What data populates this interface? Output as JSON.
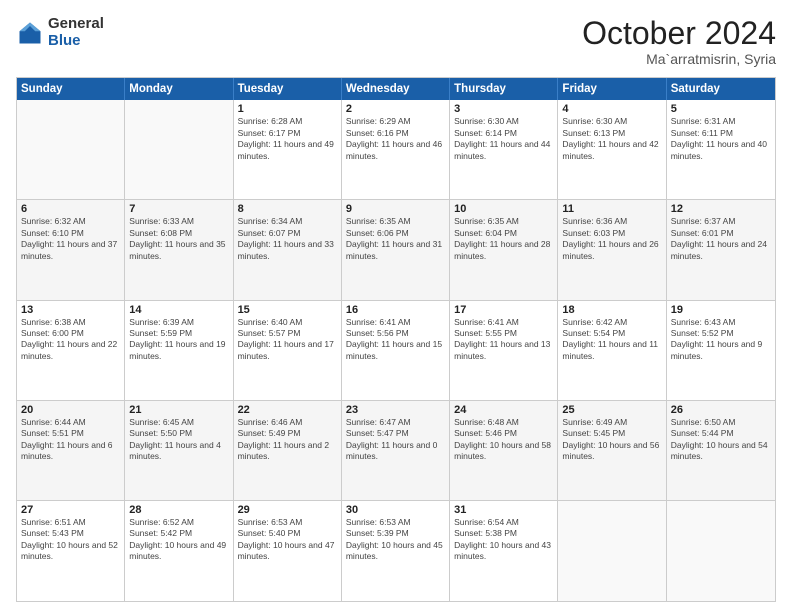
{
  "logo": {
    "general": "General",
    "blue": "Blue"
  },
  "header": {
    "month": "October 2024",
    "location": "Ma`arratmisrin, Syria"
  },
  "weekdays": [
    "Sunday",
    "Monday",
    "Tuesday",
    "Wednesday",
    "Thursday",
    "Friday",
    "Saturday"
  ],
  "weeks": [
    [
      {
        "day": "",
        "info": ""
      },
      {
        "day": "",
        "info": ""
      },
      {
        "day": "1",
        "info": "Sunrise: 6:28 AM\nSunset: 6:17 PM\nDaylight: 11 hours and 49 minutes."
      },
      {
        "day": "2",
        "info": "Sunrise: 6:29 AM\nSunset: 6:16 PM\nDaylight: 11 hours and 46 minutes."
      },
      {
        "day": "3",
        "info": "Sunrise: 6:30 AM\nSunset: 6:14 PM\nDaylight: 11 hours and 44 minutes."
      },
      {
        "day": "4",
        "info": "Sunrise: 6:30 AM\nSunset: 6:13 PM\nDaylight: 11 hours and 42 minutes."
      },
      {
        "day": "5",
        "info": "Sunrise: 6:31 AM\nSunset: 6:11 PM\nDaylight: 11 hours and 40 minutes."
      }
    ],
    [
      {
        "day": "6",
        "info": "Sunrise: 6:32 AM\nSunset: 6:10 PM\nDaylight: 11 hours and 37 minutes."
      },
      {
        "day": "7",
        "info": "Sunrise: 6:33 AM\nSunset: 6:08 PM\nDaylight: 11 hours and 35 minutes."
      },
      {
        "day": "8",
        "info": "Sunrise: 6:34 AM\nSunset: 6:07 PM\nDaylight: 11 hours and 33 minutes."
      },
      {
        "day": "9",
        "info": "Sunrise: 6:35 AM\nSunset: 6:06 PM\nDaylight: 11 hours and 31 minutes."
      },
      {
        "day": "10",
        "info": "Sunrise: 6:35 AM\nSunset: 6:04 PM\nDaylight: 11 hours and 28 minutes."
      },
      {
        "day": "11",
        "info": "Sunrise: 6:36 AM\nSunset: 6:03 PM\nDaylight: 11 hours and 26 minutes."
      },
      {
        "day": "12",
        "info": "Sunrise: 6:37 AM\nSunset: 6:01 PM\nDaylight: 11 hours and 24 minutes."
      }
    ],
    [
      {
        "day": "13",
        "info": "Sunrise: 6:38 AM\nSunset: 6:00 PM\nDaylight: 11 hours and 22 minutes."
      },
      {
        "day": "14",
        "info": "Sunrise: 6:39 AM\nSunset: 5:59 PM\nDaylight: 11 hours and 19 minutes."
      },
      {
        "day": "15",
        "info": "Sunrise: 6:40 AM\nSunset: 5:57 PM\nDaylight: 11 hours and 17 minutes."
      },
      {
        "day": "16",
        "info": "Sunrise: 6:41 AM\nSunset: 5:56 PM\nDaylight: 11 hours and 15 minutes."
      },
      {
        "day": "17",
        "info": "Sunrise: 6:41 AM\nSunset: 5:55 PM\nDaylight: 11 hours and 13 minutes."
      },
      {
        "day": "18",
        "info": "Sunrise: 6:42 AM\nSunset: 5:54 PM\nDaylight: 11 hours and 11 minutes."
      },
      {
        "day": "19",
        "info": "Sunrise: 6:43 AM\nSunset: 5:52 PM\nDaylight: 11 hours and 9 minutes."
      }
    ],
    [
      {
        "day": "20",
        "info": "Sunrise: 6:44 AM\nSunset: 5:51 PM\nDaylight: 11 hours and 6 minutes."
      },
      {
        "day": "21",
        "info": "Sunrise: 6:45 AM\nSunset: 5:50 PM\nDaylight: 11 hours and 4 minutes."
      },
      {
        "day": "22",
        "info": "Sunrise: 6:46 AM\nSunset: 5:49 PM\nDaylight: 11 hours and 2 minutes."
      },
      {
        "day": "23",
        "info": "Sunrise: 6:47 AM\nSunset: 5:47 PM\nDaylight: 11 hours and 0 minutes."
      },
      {
        "day": "24",
        "info": "Sunrise: 6:48 AM\nSunset: 5:46 PM\nDaylight: 10 hours and 58 minutes."
      },
      {
        "day": "25",
        "info": "Sunrise: 6:49 AM\nSunset: 5:45 PM\nDaylight: 10 hours and 56 minutes."
      },
      {
        "day": "26",
        "info": "Sunrise: 6:50 AM\nSunset: 5:44 PM\nDaylight: 10 hours and 54 minutes."
      }
    ],
    [
      {
        "day": "27",
        "info": "Sunrise: 6:51 AM\nSunset: 5:43 PM\nDaylight: 10 hours and 52 minutes."
      },
      {
        "day": "28",
        "info": "Sunrise: 6:52 AM\nSunset: 5:42 PM\nDaylight: 10 hours and 49 minutes."
      },
      {
        "day": "29",
        "info": "Sunrise: 6:53 AM\nSunset: 5:40 PM\nDaylight: 10 hours and 47 minutes."
      },
      {
        "day": "30",
        "info": "Sunrise: 6:53 AM\nSunset: 5:39 PM\nDaylight: 10 hours and 45 minutes."
      },
      {
        "day": "31",
        "info": "Sunrise: 6:54 AM\nSunset: 5:38 PM\nDaylight: 10 hours and 43 minutes."
      },
      {
        "day": "",
        "info": ""
      },
      {
        "day": "",
        "info": ""
      }
    ]
  ]
}
